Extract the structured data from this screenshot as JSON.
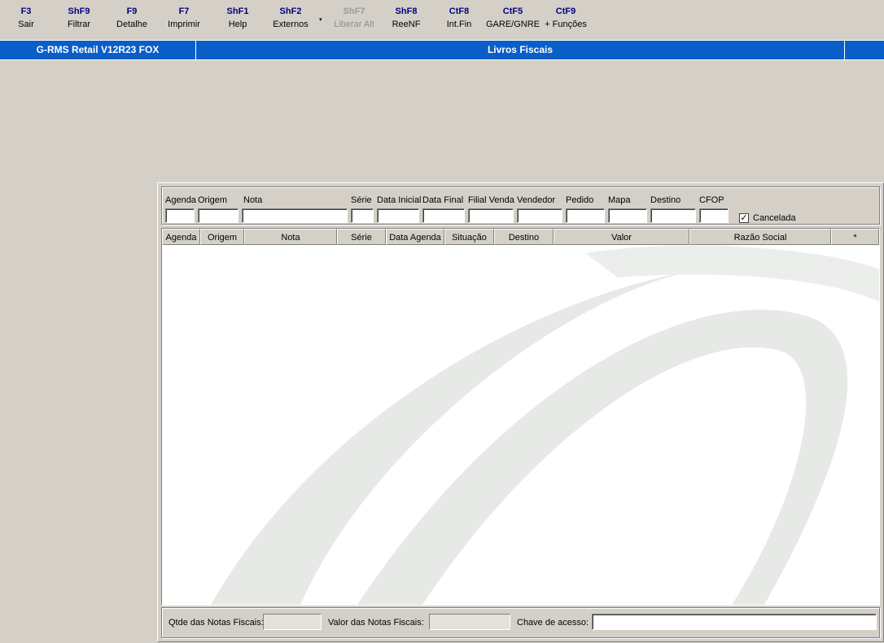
{
  "toolbar": {
    "buttons": [
      {
        "key": "F3",
        "label": "Sair"
      },
      {
        "key": "ShF9",
        "label": "Filtrar"
      },
      {
        "key": "F9",
        "label": "Detalhe"
      },
      {
        "key": "F7",
        "label": "Imprimir"
      },
      {
        "key": "ShF1",
        "label": "Help"
      },
      {
        "key": "ShF2",
        "label": "Externos"
      },
      {
        "key": "ShF7",
        "label": "Liberar Alt"
      },
      {
        "key": "ShF8",
        "label": "ReeNF"
      },
      {
        "key": "CtF8",
        "label": "Int.Fin"
      },
      {
        "key": "CtF5",
        "label": "GARE/GNRE"
      },
      {
        "key": "CtF9",
        "label": "+ Funções"
      }
    ],
    "caret": "▾"
  },
  "titlebar": {
    "app_title": "G-RMS Retail V12R23 FOX",
    "screen_title": "Livros Fiscais"
  },
  "filters": {
    "labels": [
      "Agenda",
      "Origem",
      "Nota",
      "Série",
      "Data Inicial",
      "Data Final",
      "Filial Venda",
      "Vendedor",
      "Pedido",
      "Mapa",
      "Destino",
      "CFOP"
    ],
    "values": [
      "",
      "",
      "",
      "",
      "",
      "",
      "",
      "",
      "",
      "",
      "",
      ""
    ],
    "cancelada_label": "Cancelada",
    "cancelada_checked": true,
    "check_glyph": "✓"
  },
  "grid": {
    "columns": [
      "Agenda",
      "Origem",
      "Nota",
      "Série",
      "Data Agenda",
      "Situação",
      "Destino",
      "Valor",
      "Razão Social",
      "*"
    ],
    "rows": []
  },
  "footer": {
    "qtde_label": "Qtde das Notas Fiscais:",
    "qtde_value": "",
    "valor_label": "Valor  das Notas Fiscais:",
    "valor_value": "",
    "chave_label": "Chave de acesso:",
    "chave_value": ""
  },
  "colors": {
    "titlebar_bg": "#0a5ec8",
    "toolbar_key": "#000080",
    "window_bg": "#d4d0c8"
  }
}
